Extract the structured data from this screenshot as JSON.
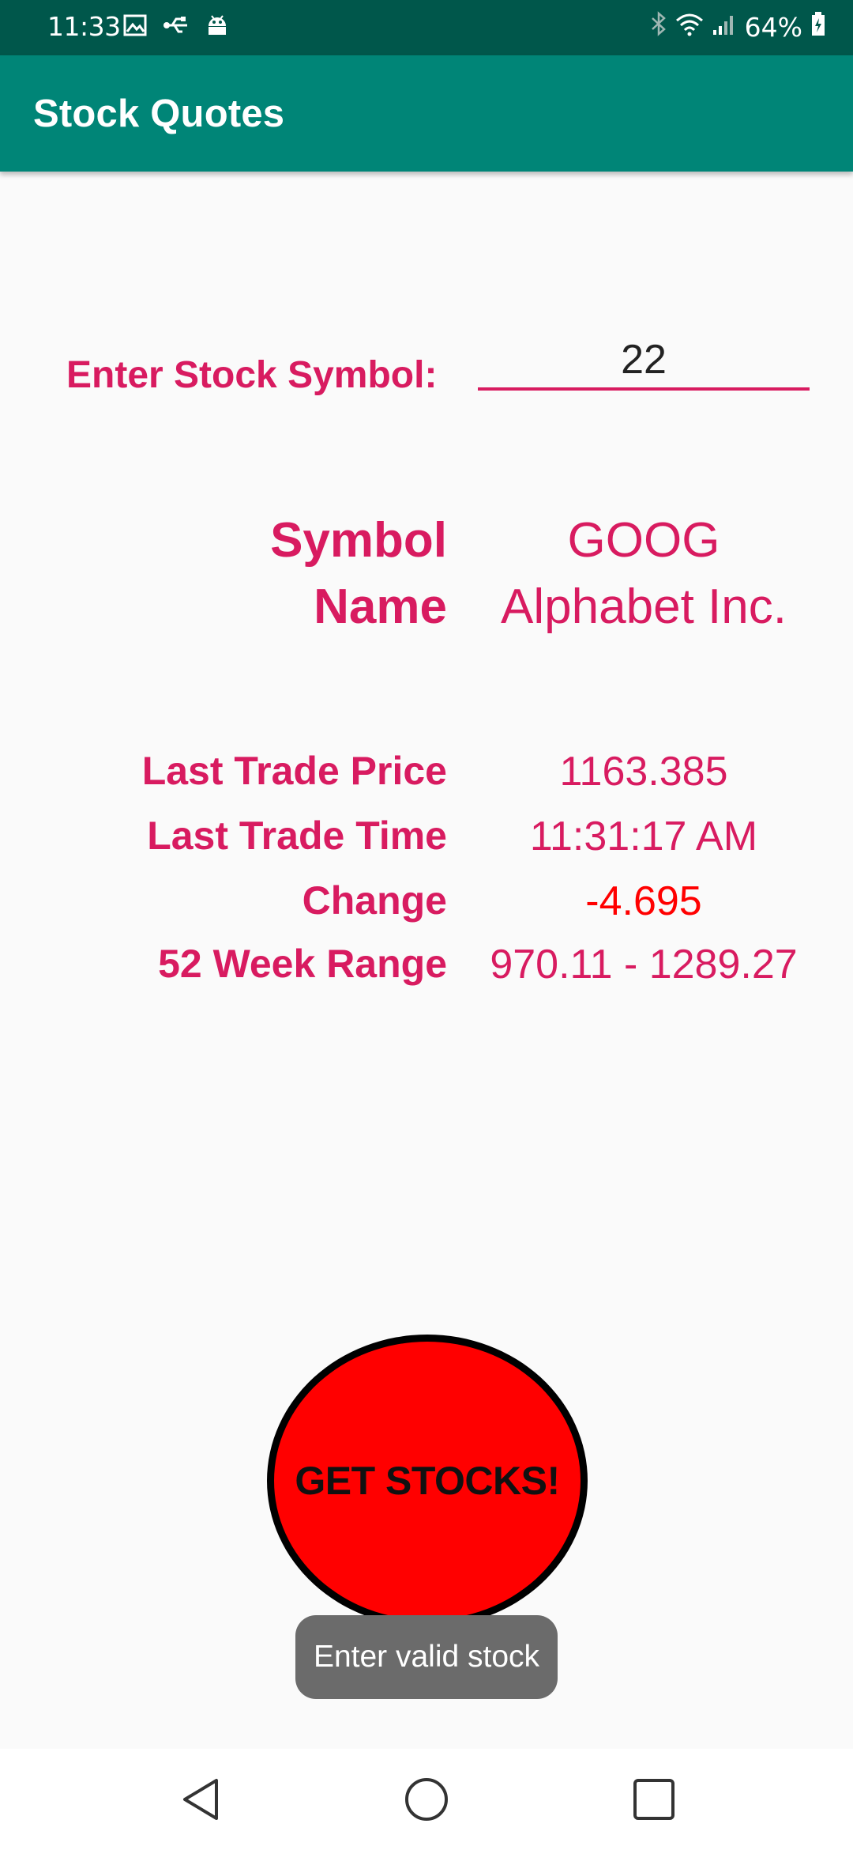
{
  "status_bar": {
    "time": "11:33",
    "battery": "64%",
    "icons": [
      "image-icon",
      "usb-icon",
      "android-debug-icon",
      "bluetooth-icon",
      "wifi-icon",
      "signal-icon",
      "battery-icon"
    ]
  },
  "app_bar": {
    "title": "Stock Quotes",
    "color": "#008577"
  },
  "form": {
    "symbol_label": "Enter Stock Symbol:",
    "symbol_value": "22"
  },
  "quote": {
    "symbol_label": "Symbol",
    "symbol_value": "GOOG",
    "name_label": "Name",
    "name_value": "Alphabet Inc.",
    "last_trade_price_label": "Last Trade Price",
    "last_trade_price_value": "1163.385",
    "last_trade_time_label": "Last Trade Time",
    "last_trade_time_value": "11:31:17 AM",
    "change_label": "Change",
    "change_value": "-4.695",
    "range_label": "52 Week Range",
    "range_value": "970.11 - 1289.27"
  },
  "actions": {
    "get_stocks_label": "GET STOCKS!"
  },
  "toast": {
    "message": "Enter valid stock"
  },
  "colors": {
    "accent": "#d81b60",
    "negative": "#ff0000",
    "button": "#ff0000"
  },
  "nav": {
    "icons": [
      "back-icon",
      "home-icon",
      "recents-icon"
    ]
  }
}
